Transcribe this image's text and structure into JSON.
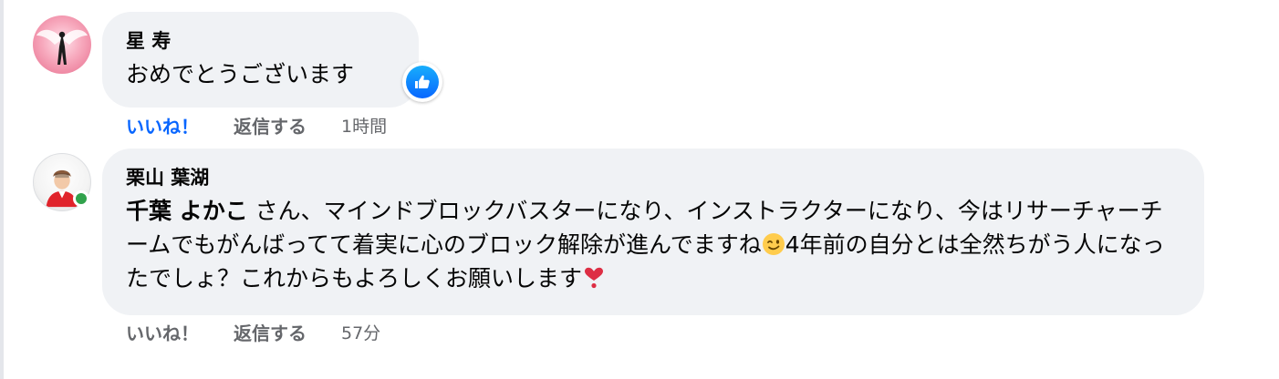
{
  "comments": [
    {
      "author": "星 寿",
      "text": "おめでとうございます",
      "reaction_icon": "like-icon",
      "actions": {
        "like_label": "いいね！",
        "like_active": true,
        "reply_label": "返信する",
        "timestamp": "1時間"
      }
    },
    {
      "author": "栗山 葉湖",
      "online": true,
      "mention": "千葉 よかこ",
      "text_part1": " さん、マインドブロックバスターになり、インストラクターになり、今はリサーチャーチームでもがんばってて着実に心のブロック解除が進んでますね",
      "emoji_1": "winking-face-emoji",
      "text_part2": "4年前の自分とは全然ちがう人になったでしょ？これからもよろしくお願いします",
      "emoji_2": "heart-exclamation-emoji",
      "actions": {
        "like_label": "いいね！",
        "like_active": false,
        "reply_label": "返信する",
        "timestamp": "57分"
      }
    }
  ],
  "colors": {
    "bubble": "#f0f2f5",
    "liked": "#0866ff",
    "meta": "#65676b",
    "online": "#31a24c"
  }
}
